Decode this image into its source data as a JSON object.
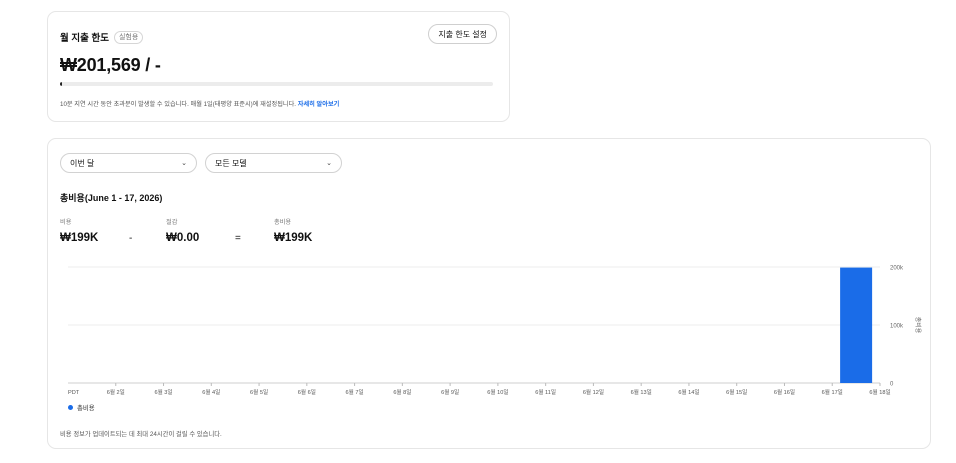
{
  "limit": {
    "title": "월 지출 한도",
    "badge": "실험용",
    "set_button": "지출 한도 설정",
    "amount": "₩201,569 / -",
    "progress_fraction": 0.005,
    "note": "10분 지연 시간 동안 초과분이 발생할 수 있습니다. 매월 1일(태평양 표준시)에 재설정됩니다.",
    "learn_more": "자세히 알아보기"
  },
  "filters": {
    "period": "이번 달",
    "model": "모든 모델"
  },
  "usage": {
    "title": "총비용(June 1 - 17, 2026)",
    "stats": [
      {
        "label": "비용",
        "value": "₩199K"
      },
      {
        "label": "절감",
        "value": "₩0.00"
      },
      {
        "label": "총비용",
        "value": "₩199K"
      }
    ],
    "operators": [
      "-",
      "="
    ],
    "footnote": "비용 정보가 업데이트되는 데 최대 24시간이 걸릴 수 있습니다."
  },
  "chart_data": {
    "type": "bar",
    "categories": [
      "PDT",
      "6월 2일",
      "6월 3일",
      "6월 4일",
      "6월 5일",
      "6월 6일",
      "6월 7일",
      "6월 8일",
      "6월 9일",
      "6월 10일",
      "6월 11일",
      "6월 12일",
      "6월 13일",
      "6월 14일",
      "6월 15일",
      "6월 16일",
      "6월 17일",
      "6월 18일"
    ],
    "series": [
      {
        "name": "총비용",
        "values": [
          0,
          0,
          0,
          0,
          0,
          0,
          0,
          0,
          0,
          0,
          0,
          0,
          0,
          0,
          0,
          0,
          199000,
          0
        ]
      }
    ],
    "ylim": [
      0,
      200000
    ],
    "yticks": [
      0,
      100000,
      200000
    ],
    "ytick_labels": [
      "0",
      "100k",
      "200k"
    ],
    "ylabel": "총비용",
    "grid": true,
    "legend": "bottom-left",
    "color": "#1a6ce8"
  }
}
